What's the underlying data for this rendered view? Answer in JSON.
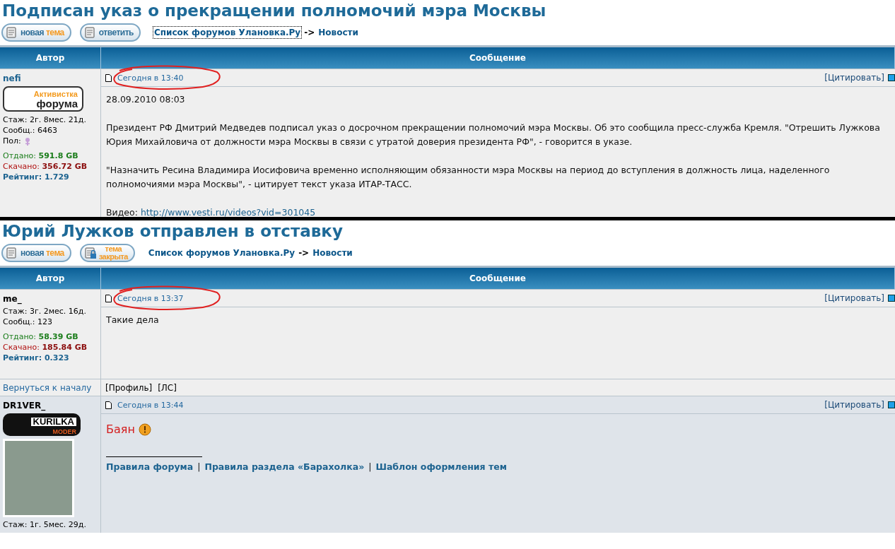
{
  "topics": [
    {
      "title": "Подписан указ о прекращении полномочий мэра Москвы",
      "buttons": [
        {
          "kind": "new",
          "words": [
            "новая",
            "тема"
          ]
        },
        {
          "kind": "reply",
          "words": [
            "ответить"
          ]
        }
      ],
      "breadcrumb": {
        "forum": "Список форумов Улановка.Ру",
        "separator": "->",
        "section": "Новости",
        "focused": true
      },
      "columns": [
        "Автор",
        "Сообщение"
      ],
      "posts": [
        {
          "author": "nefi",
          "alternate": false,
          "badge": {
            "kind": "activist",
            "lines": [
              "Активистка",
              "форума"
            ]
          },
          "stats": [
            "Стаж: 2г. 8мес. 21д.",
            "Сообщ.: 6463"
          ],
          "gender": {
            "label": "Пол:",
            "kind": "female"
          },
          "uploaded": {
            "label": "Отдано:",
            "value": "591.8 GB"
          },
          "downloaded": {
            "label": "Скачано:",
            "value": "356.72 GB"
          },
          "rating": {
            "label": "Рейтинг:",
            "value": "1.729"
          },
          "date": "Сегодня в 13:40",
          "circled": true,
          "quote": "[Цитировать]",
          "body": [
            {
              "kind": "text",
              "text": "28.09.2010 08:03"
            },
            {
              "kind": "text",
              "text": "Президент РФ Дмитрий Медведев подписал указ о досрочном прекращении полномочий мэра Москвы. Об это сообщила пресс-служба Кремля. \"Отрешить Лужкова Юрия Михайловича от должности мэра Москвы в связи с утратой доверия президента РФ\", - говорится в указе."
            },
            {
              "kind": "text",
              "text": "\"Назначить Ресина Владимира Иосифовича временно исполняющим обязанности мэра Москвы на период до вступления в должность лица, наделенного полномочиями мэра Москвы\", - цитирует текст указа ИТАР-ТАСС."
            },
            {
              "kind": "link",
              "text": "Видео:",
              "link": "http://www.vesti.ru/videos?vid=301045"
            }
          ]
        }
      ]
    },
    {
      "title": "Юрий Лужков отправлен в отставку",
      "buttons": [
        {
          "kind": "new",
          "words": [
            "новая",
            "тема"
          ]
        },
        {
          "kind": "locked",
          "words": [
            "тема",
            "закрыта"
          ]
        }
      ],
      "breadcrumb": {
        "forum": "Список форумов Улановка.Ру",
        "separator": "->",
        "section": "Новости",
        "focused": false
      },
      "columns": [
        "Автор",
        "Сообщение"
      ],
      "posts": [
        {
          "author": "me_",
          "alternate": false,
          "stats": [
            "Стаж: 3г. 2мес. 16д.",
            "Сообщ.: 123"
          ],
          "uploaded": {
            "label": "Отдано:",
            "value": "58.39 GB"
          },
          "downloaded": {
            "label": "Скачано:",
            "value": "185.84 GB"
          },
          "rating": {
            "label": "Рейтинг:",
            "value": "0.323"
          },
          "date": "Сегодня в 13:37",
          "circled": true,
          "quote": "[Цитировать]",
          "body": [
            {
              "kind": "text",
              "text": "Такие дела"
            }
          ],
          "footer": {
            "back": "Вернуться к началу",
            "links": [
              "[Профиль]",
              "[ЛС]"
            ]
          }
        },
        {
          "author": "DR1VER_",
          "alternate": true,
          "badge": {
            "kind": "moder",
            "lines": [
              "KURILKA",
              "MODER"
            ]
          },
          "avatar": true,
          "stats": [
            "Стаж: 1г. 5мес. 29д."
          ],
          "date": "Сегодня в 13:44",
          "circled": false,
          "quote": "[Цитировать]",
          "body": [
            {
              "kind": "warning",
              "text": "Баян"
            },
            {
              "kind": "signature",
              "links": [
                "Правила форума",
                "Правила раздела «Барахолка»",
                "Шаблон оформления тем"
              ],
              "separator": "|"
            }
          ]
        }
      ]
    }
  ]
}
